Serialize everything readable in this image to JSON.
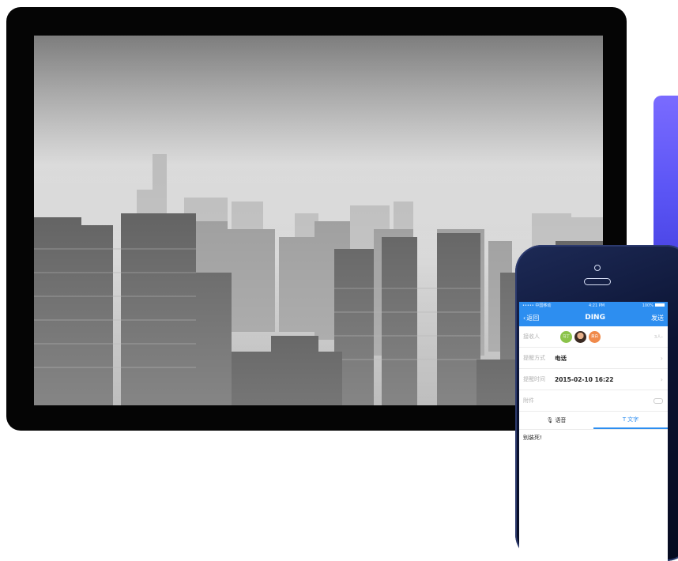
{
  "phone": {
    "status": {
      "carrier": "••••• 中国移动",
      "time": "4:21 PM",
      "battery": "100%"
    },
    "nav": {
      "back_label": "返回",
      "title": "DING",
      "send_label": "发送"
    },
    "recipients": {
      "label": "接收人",
      "avatars": [
        "马丁",
        "",
        "黄白"
      ],
      "count": "3人"
    },
    "method": {
      "label": "提醒方式",
      "value": "电话"
    },
    "time": {
      "label": "提醒时间",
      "value": "2015-02-10 16:22"
    },
    "attachment": {
      "label": "附件"
    },
    "tabs": {
      "voice": "语音",
      "text": "文字"
    },
    "message": "别装死!"
  },
  "icons": {
    "back": "chevron-left-icon",
    "arrow": "chevron-right-icon",
    "mic": "microphone-icon",
    "text": "text-icon",
    "clip": "paperclip-icon"
  },
  "colors": {
    "accent": "#2d8ef0",
    "panel": "#5b55f5",
    "frame": "#050505"
  }
}
